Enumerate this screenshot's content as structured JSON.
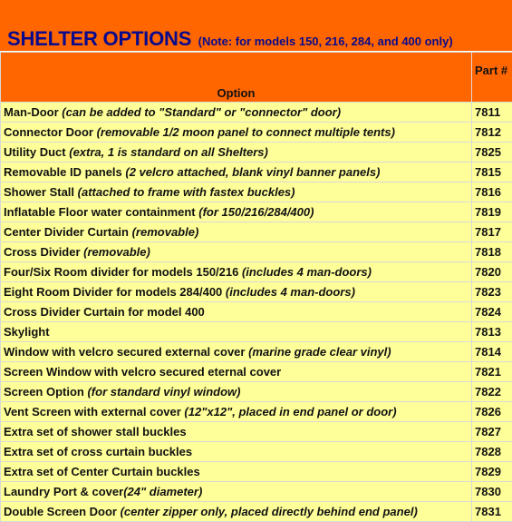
{
  "title": "SHELTER OPTIONS",
  "title_note": "(Note: for models 150, 216, 284, and 400 only)",
  "headers": {
    "option": "Option",
    "part": "Part #"
  },
  "rows": [
    {
      "name": "Man-Door ",
      "note": "(can be added to \"Standard\" or \"connector\" door)",
      "part": "7811"
    },
    {
      "name": "Connector Door ",
      "note": "(removable 1/2 moon panel to connect multiple tents)",
      "part": "7812"
    },
    {
      "name": "Utility Duct ",
      "note": "(extra, 1 is standard on all Shelters)",
      "part": "7825"
    },
    {
      "name": "Removable ID panels ",
      "note": "(2 velcro attached, blank vinyl banner panels)",
      "part": "7815"
    },
    {
      "name": "Shower Stall ",
      "note": "(attached to frame with fastex buckles)",
      "part": "7816"
    },
    {
      "name": "Inflatable Floor water containment ",
      "note": "(for 150/216/284/400)",
      "part": "7819"
    },
    {
      "name": "Center Divider Curtain ",
      "note": "(removable)",
      "part": "7817"
    },
    {
      "name": "Cross Divider ",
      "note": "(removable)",
      "part": "7818"
    },
    {
      "name": "Four/Six Room divider for models 150/216 ",
      "note": "(includes 4 man-doors)",
      "part": "7820"
    },
    {
      "name": "Eight Room Divider for models 284/400 ",
      "note": "(includes 4 man-doors)",
      "part": "7823"
    },
    {
      "name": "Cross Divider Curtain for model 400",
      "note": "",
      "part": "7824"
    },
    {
      "name": "Skylight",
      "note": "",
      "part": "7813"
    },
    {
      "name": "Window with velcro secured external cover ",
      "note": "(marine grade clear vinyl)",
      "part": "7814"
    },
    {
      "name": "Screen Window with velcro secured eternal cover",
      "note": "",
      "part": "7821"
    },
    {
      "name": "Screen Option ",
      "note": "(for standard vinyl window)",
      "part": "7822"
    },
    {
      "name": "Vent Screen with external cover ",
      "note": "(12\"x12\", placed in end panel or door)",
      "part": "7826"
    },
    {
      "name": "Extra set of shower stall buckles",
      "note": "",
      "part": "7827"
    },
    {
      "name": "Extra set of cross curtain buckles",
      "note": "",
      "part": "7828"
    },
    {
      "name": "Extra set of Center Curtain buckles",
      "note": "",
      "part": "7829"
    },
    {
      "name": "Laundry Port & cover",
      "note": "(24\" diameter)",
      "part": "7830"
    },
    {
      "name": "Double Screen Door ",
      "note": "(center zipper only, placed directly behind end panel)",
      "part": "7831"
    }
  ],
  "colors": {
    "banner": "#ff6600",
    "title": "#0a0a8c",
    "row_background": "#ffff99"
  }
}
